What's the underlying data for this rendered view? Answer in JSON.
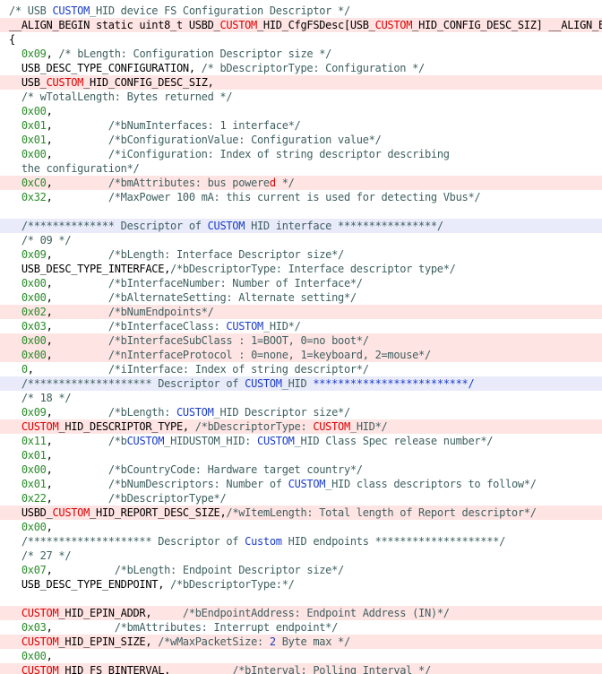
{
  "colors": {
    "text": "#000000",
    "comment": "#3f5f5f",
    "number": "#2a8c2a",
    "macro_highlight": "#dc0000",
    "blue_highlight": "#1a3cc8",
    "row_pink": "#ffe4e4",
    "row_blue": "#e9ebfa"
  },
  "lines": [
    {
      "hl": "",
      "segs": [
        [
          "c",
          "/* USB "
        ],
        [
          "b",
          "CUSTOM"
        ],
        [
          "c",
          "_HID device FS Configuration Descriptor */"
        ]
      ]
    },
    {
      "hl": "pink",
      "segs": [
        [
          "k",
          "__ALIGN_BEGIN static uint8_t USBD_"
        ],
        [
          "m",
          "CUSTOM"
        ],
        [
          "k",
          "_HID_CfgFSDesc[USB_"
        ],
        [
          "m",
          "CUSTOM"
        ],
        [
          "k",
          "_HID_CONFIG_DESC_SIZ] __ALIGN_END ="
        ]
      ]
    },
    {
      "hl": "",
      "segs": [
        [
          "k",
          "{"
        ]
      ]
    },
    {
      "hl": "",
      "segs": [
        [
          "n",
          "  0x09"
        ],
        [
          "k",
          ", "
        ],
        [
          "c",
          "/* bLength: Configuration Descriptor size */"
        ]
      ]
    },
    {
      "hl": "",
      "segs": [
        [
          "k",
          "  USB_DESC_TYPE_CONFIGURATION, "
        ],
        [
          "c",
          "/* bDescriptorType: Configuration */"
        ]
      ]
    },
    {
      "hl": "pink",
      "segs": [
        [
          "k",
          "  USB_"
        ],
        [
          "m",
          "CUSTOM"
        ],
        [
          "k",
          "_HID_CONFIG_DESC_SIZ,"
        ]
      ]
    },
    {
      "hl": "",
      "segs": [
        [
          "c",
          "  /* wTotalLength: Bytes returned */"
        ]
      ]
    },
    {
      "hl": "",
      "segs": [
        [
          "n",
          "  0x00"
        ],
        [
          "k",
          ","
        ]
      ]
    },
    {
      "hl": "",
      "segs": [
        [
          "n",
          "  0x01"
        ],
        [
          "k",
          ",         "
        ],
        [
          "c",
          "/*bNumInterfaces: 1 interface*/"
        ]
      ]
    },
    {
      "hl": "",
      "segs": [
        [
          "n",
          "  0x01"
        ],
        [
          "k",
          ",         "
        ],
        [
          "c",
          "/*bConfigurationValue: Configuration value*/"
        ]
      ]
    },
    {
      "hl": "",
      "segs": [
        [
          "n",
          "  0x00"
        ],
        [
          "k",
          ",         "
        ],
        [
          "c",
          "/*iConfiguration: Index of string descriptor describing"
        ]
      ]
    },
    {
      "hl": "",
      "segs": [
        [
          "c",
          "  the configuration*/"
        ]
      ]
    },
    {
      "hl": "pink",
      "segs": [
        [
          "n",
          "  0xC0"
        ],
        [
          "k",
          ",         "
        ],
        [
          "c",
          "/*bmAttributes: bus powere"
        ],
        [
          "m",
          "d"
        ],
        [
          "c",
          " */"
        ]
      ]
    },
    {
      "hl": "",
      "segs": [
        [
          "n",
          "  0x32"
        ],
        [
          "k",
          ",         "
        ],
        [
          "c",
          "/*MaxPower 100 mA: this current is used for detecting Vbus*/"
        ]
      ]
    },
    {
      "hl": "",
      "segs": [
        [
          "k",
          " "
        ]
      ]
    },
    {
      "hl": "blue",
      "segs": [
        [
          "c",
          "  /************** Descriptor of "
        ],
        [
          "b",
          "CUSTOM"
        ],
        [
          "c",
          " HID interface ****************/"
        ]
      ]
    },
    {
      "hl": "",
      "segs": [
        [
          "c",
          "  /* 09 */"
        ]
      ]
    },
    {
      "hl": "",
      "segs": [
        [
          "n",
          "  0x09"
        ],
        [
          "k",
          ",         "
        ],
        [
          "c",
          "/*bLength: Interface Descriptor size*/"
        ]
      ]
    },
    {
      "hl": "",
      "segs": [
        [
          "k",
          "  USB_DESC_TYPE_INTERFACE,"
        ],
        [
          "c",
          "/*bDescriptorType: Interface descriptor type*/"
        ]
      ]
    },
    {
      "hl": "",
      "segs": [
        [
          "n",
          "  0x00"
        ],
        [
          "k",
          ",         "
        ],
        [
          "c",
          "/*bInterfaceNumber: Number of Interface*/"
        ]
      ]
    },
    {
      "hl": "",
      "segs": [
        [
          "n",
          "  0x00"
        ],
        [
          "k",
          ",         "
        ],
        [
          "c",
          "/*bAlternateSetting: Alternate setting*/"
        ]
      ]
    },
    {
      "hl": "pink",
      "segs": [
        [
          "n",
          "  0x02"
        ],
        [
          "k",
          ",         "
        ],
        [
          "c",
          "/*bNumEndpoints*/"
        ]
      ]
    },
    {
      "hl": "",
      "segs": [
        [
          "n",
          "  0x03"
        ],
        [
          "k",
          ",         "
        ],
        [
          "c",
          "/*bInterfaceClass: "
        ],
        [
          "b",
          "CUSTOM"
        ],
        [
          "c",
          "_HID*/"
        ]
      ]
    },
    {
      "hl": "pink",
      "segs": [
        [
          "n",
          "  0x00"
        ],
        [
          "k",
          ",         "
        ],
        [
          "c",
          "/*bInterfaceSubClass : 1=BOOT, 0=no boot*/"
        ]
      ]
    },
    {
      "hl": "pink",
      "segs": [
        [
          "n",
          "  0x00"
        ],
        [
          "k",
          ",         "
        ],
        [
          "c",
          "/*nInterfaceProtocol : 0=none, 1=keyboard, 2=mouse*/"
        ]
      ]
    },
    {
      "hl": "",
      "segs": [
        [
          "n",
          "  0"
        ],
        [
          "k",
          ",            "
        ],
        [
          "c",
          "/*iInterface: Index of string descriptor*/"
        ]
      ]
    },
    {
      "hl": "blue",
      "segs": [
        [
          "c",
          "  /******************** Descriptor of "
        ],
        [
          "b",
          "CUSTOM"
        ],
        [
          "c",
          "_HID "
        ],
        [
          "b",
          "*************************/"
        ]
      ]
    },
    {
      "hl": "",
      "segs": [
        [
          "c",
          "  /* 18 */"
        ]
      ]
    },
    {
      "hl": "",
      "segs": [
        [
          "n",
          "  0x09"
        ],
        [
          "k",
          ",         "
        ],
        [
          "c",
          "/*bLength: "
        ],
        [
          "b",
          "CUSTOM"
        ],
        [
          "c",
          "_HID Descriptor size*/"
        ]
      ]
    },
    {
      "hl": "pink",
      "segs": [
        [
          "m",
          "  CUSTOM"
        ],
        [
          "k",
          "_HID_DESCRIPTOR_TYPE, "
        ],
        [
          "c",
          "/*bDescriptorType: "
        ],
        [
          "m",
          "CUSTOM"
        ],
        [
          "c",
          "_HID*/"
        ]
      ]
    },
    {
      "hl": "",
      "segs": [
        [
          "n",
          "  0x11"
        ],
        [
          "k",
          ",         "
        ],
        [
          "c",
          "/*b"
        ],
        [
          "b",
          "CUSTOM"
        ],
        [
          "c",
          "_HIDUSTOM_HID: "
        ],
        [
          "b",
          "CUSTOM"
        ],
        [
          "c",
          "_HID Class Spec release number*/"
        ]
      ]
    },
    {
      "hl": "",
      "segs": [
        [
          "n",
          "  0x01"
        ],
        [
          "k",
          ","
        ]
      ]
    },
    {
      "hl": "",
      "segs": [
        [
          "n",
          "  0x00"
        ],
        [
          "k",
          ",         "
        ],
        [
          "c",
          "/*bCountryCode: Hardware target country*/"
        ]
      ]
    },
    {
      "hl": "",
      "segs": [
        [
          "n",
          "  0x01"
        ],
        [
          "k",
          ",         "
        ],
        [
          "c",
          "/*bNumDescriptors: Number of "
        ],
        [
          "b",
          "CUSTOM"
        ],
        [
          "c",
          "_HID class descriptors to follow*/"
        ]
      ]
    },
    {
      "hl": "",
      "segs": [
        [
          "n",
          "  0x22"
        ],
        [
          "k",
          ",         "
        ],
        [
          "c",
          "/*bDescriptorType*/"
        ]
      ]
    },
    {
      "hl": "pink",
      "segs": [
        [
          "k",
          "  USBD_"
        ],
        [
          "m",
          "CUSTOM"
        ],
        [
          "k",
          "_HID_REPORT_DESC_SIZE,"
        ],
        [
          "c",
          "/*wItemLength: Total length of Report descriptor*/"
        ]
      ]
    },
    {
      "hl": "",
      "segs": [
        [
          "n",
          "  0x00"
        ],
        [
          "k",
          ","
        ]
      ]
    },
    {
      "hl": "",
      "segs": [
        [
          "c",
          "  /******************** Descriptor of "
        ],
        [
          "b",
          "Custom"
        ],
        [
          "c",
          " HID endpoints ********************/"
        ]
      ]
    },
    {
      "hl": "",
      "segs": [
        [
          "c",
          "  /* 27 */"
        ]
      ]
    },
    {
      "hl": "",
      "segs": [
        [
          "n",
          "  0x07"
        ],
        [
          "k",
          ",          "
        ],
        [
          "c",
          "/*bLength: Endpoint Descriptor size*/"
        ]
      ]
    },
    {
      "hl": "",
      "segs": [
        [
          "k",
          "  USB_DESC_TYPE_ENDPOINT, "
        ],
        [
          "c",
          "/*bDescriptorType:*/"
        ]
      ]
    },
    {
      "hl": "",
      "segs": [
        [
          "k",
          " "
        ]
      ]
    },
    {
      "hl": "pink",
      "segs": [
        [
          "m",
          "  CUSTOM"
        ],
        [
          "k",
          "_HID_EPIN_ADDR,     "
        ],
        [
          "c",
          "/*bEndpointAddress: Endpoint Address (IN)*/"
        ]
      ]
    },
    {
      "hl": "",
      "segs": [
        [
          "n",
          "  0x03"
        ],
        [
          "k",
          ",          "
        ],
        [
          "c",
          "/*bmAttributes: Interrupt endpoint*/"
        ]
      ]
    },
    {
      "hl": "pink",
      "segs": [
        [
          "m",
          "  CUSTOM"
        ],
        [
          "k",
          "_HID_EPIN_SIZE, "
        ],
        [
          "c",
          "/*wMaxPacketSize: "
        ],
        [
          "b",
          "2"
        ],
        [
          "c",
          " Byte max */"
        ]
      ]
    },
    {
      "hl": "",
      "segs": [
        [
          "n",
          "  0x00"
        ],
        [
          "k",
          ","
        ]
      ]
    },
    {
      "hl": "pink",
      "segs": [
        [
          "m",
          "  CUSTOM"
        ],
        [
          "k",
          "_HID_FS_BINTERVAL,          "
        ],
        [
          "c",
          "/*bInterval: Polling Interval */"
        ]
      ]
    }
  ]
}
